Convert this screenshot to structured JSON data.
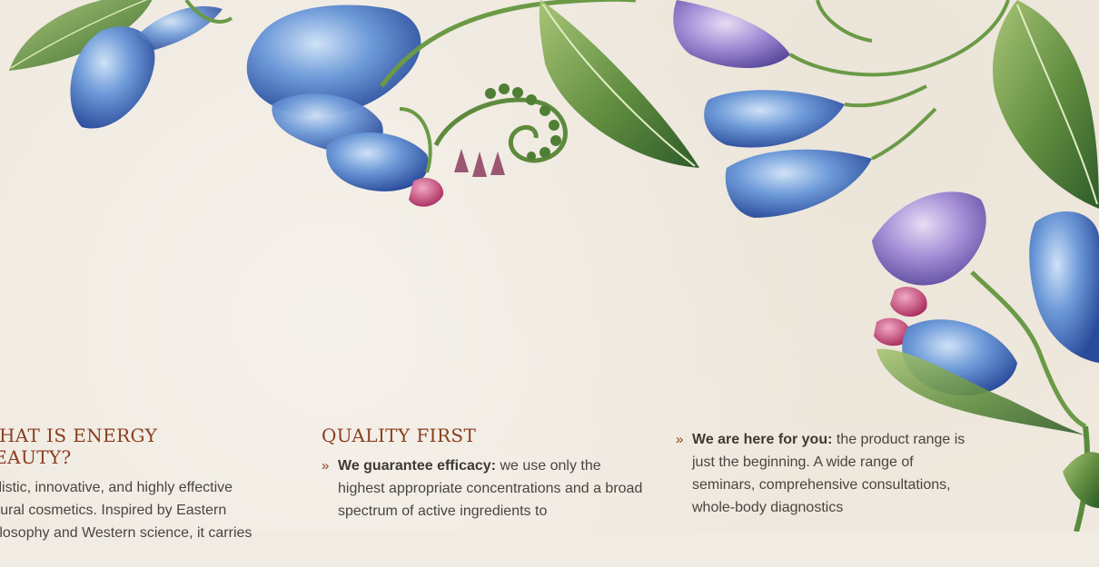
{
  "sections": {
    "energy": {
      "title": "WHAT IS ENERGY BEAUTY?",
      "lines": [
        "Holistic, innovative, and highly effective",
        "natural cosmetics. Inspired by Eastern",
        "philosophy and Western science, it carries a"
      ]
    },
    "quality": {
      "title": "QUALITY FIRST",
      "bullet": "»",
      "item_bold": "We guarantee efficacy:",
      "item_text": " we use only the highest appropriate concentrations and a broad spectrum of active ingredients to"
    },
    "support": {
      "bullet": "»",
      "item_bold": "We are here for you:",
      "item_text": " the product range is just the beginning. A wide range of seminars, comprehensive consultations, whole-body diagnostics"
    }
  }
}
